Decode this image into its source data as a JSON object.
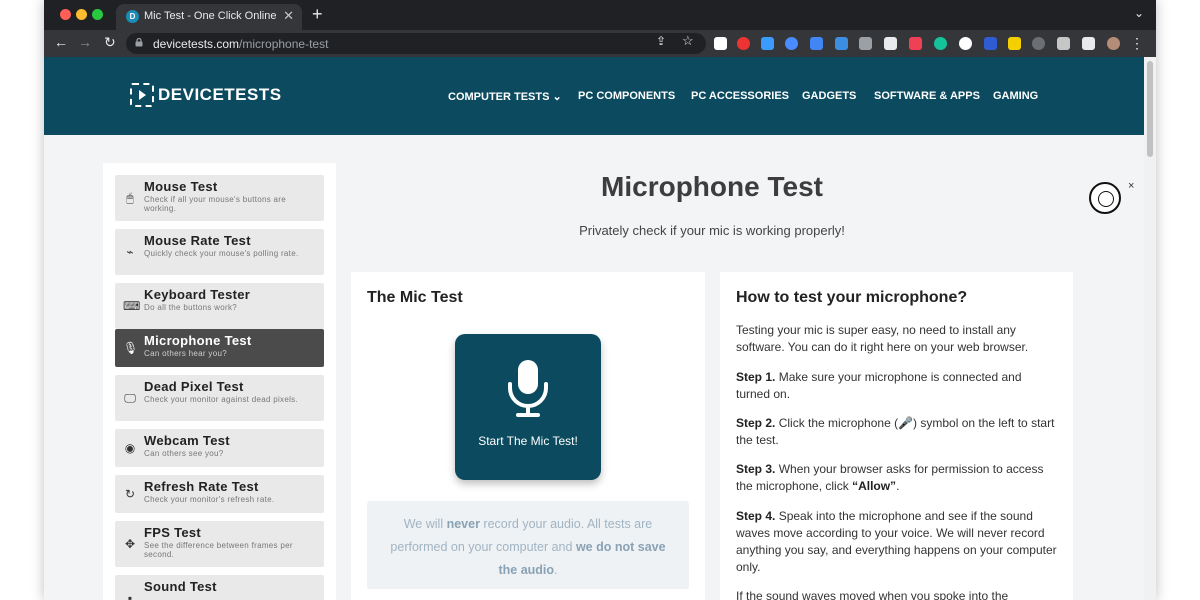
{
  "browser": {
    "tab_title": "Mic Test - One Click Online Mic",
    "url_domain": "devicetests.com",
    "url_path": "/microphone-test",
    "favicon_letter": "D",
    "new_tab": "+",
    "tab_close": "✕",
    "tab_menu": "⌄"
  },
  "site": {
    "logo_text": "DEVICETESTS",
    "nav": [
      {
        "label": "COMPUTER TESTS  ⌄"
      },
      {
        "label": "PC COMPONENTS"
      },
      {
        "label": "PC ACCESSORIES"
      },
      {
        "label": "GADGETS"
      },
      {
        "label": "SOFTWARE & APPS"
      },
      {
        "label": "GAMING"
      }
    ]
  },
  "sidebar": {
    "items": [
      {
        "title": "Mouse Test",
        "desc": "Check if all your mouse's buttons are working.",
        "icon": "mouse-icon",
        "glyph": "🖱"
      },
      {
        "title": "Mouse Rate Test",
        "desc": "Quickly check your mouse's polling rate.",
        "icon": "pulse-icon",
        "glyph": "⌁"
      },
      {
        "title": "Keyboard Tester",
        "desc": "Do all the buttons work?",
        "icon": "keyboard-icon",
        "glyph": "⌨"
      },
      {
        "title": "Microphone Test",
        "desc": "Can others hear you?",
        "icon": "microphone-icon",
        "glyph": "🎙"
      },
      {
        "title": "Dead Pixel Test",
        "desc": "Check your monitor against dead pixels.",
        "icon": "monitor-icon",
        "glyph": "🖵"
      },
      {
        "title": "Webcam Test",
        "desc": "Can others see you?",
        "icon": "webcam-icon",
        "glyph": "◉"
      },
      {
        "title": "Refresh Rate Test",
        "desc": "Check your monitor's refresh rate.",
        "icon": "refresh-icon",
        "glyph": "↻"
      },
      {
        "title": "FPS Test",
        "desc": "See the difference between frames per second.",
        "icon": "gamepad-icon",
        "glyph": "✥"
      },
      {
        "title": "Sound Test",
        "desc": "",
        "icon": "speaker-icon",
        "glyph": "▪"
      }
    ]
  },
  "main": {
    "title": "Microphone Test",
    "subtitle": "Privately check if your mic is working properly!",
    "mic_card": {
      "heading": "The Mic Test",
      "button_label": "Start The Mic Test!",
      "note_1": "We will ",
      "note_never": "never",
      "note_2": " record your audio. All tests are performed on your computer and ",
      "note_nosave": "we do not save the audio",
      "note_3": "."
    },
    "how_card": {
      "heading": "How to test your microphone?",
      "intro": "Testing your mic is super easy, no need to install any software. You can do it right here on your web browser.",
      "steps": [
        {
          "label": "Step 1.",
          "text": " Make sure your microphone is connected and turned on."
        },
        {
          "label": "Step 2.",
          "text": " Click the microphone (🎤) symbol on the left to start the test."
        },
        {
          "label": "Step 3.",
          "text": " When your browser asks for permission to access the microphone, click ",
          "bold_end": "“Allow”",
          "end": "."
        },
        {
          "label": "Step 4.",
          "text": " Speak into the microphone and see if the sound waves move according to your voice. We will never record anything you say, and everything happens on your computer only."
        }
      ],
      "trailing": "If the sound waves moved when you spoke into the"
    },
    "feedback_close": "×"
  },
  "colors": {
    "brand": "#0b4a5f",
    "active_item": "#4b4b4b"
  }
}
